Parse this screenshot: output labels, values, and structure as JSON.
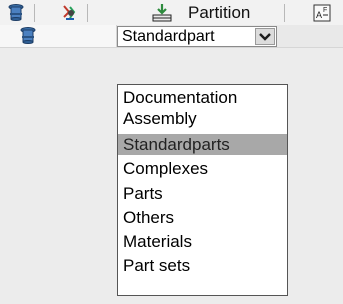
{
  "toolbar": {
    "partition_label": "Partition"
  },
  "combo": {
    "value": "Standardpart"
  },
  "dropdown": {
    "items": [
      "Documentation",
      "Assembly",
      "Standardparts",
      "Complexes",
      "Parts",
      "Others",
      "Materials",
      "Part sets"
    ],
    "selected_index": 2
  },
  "colors": {
    "selection": "#a8a8a8",
    "toolbar_bg": "#f2f2f2",
    "panel_bg": "#ececec"
  }
}
